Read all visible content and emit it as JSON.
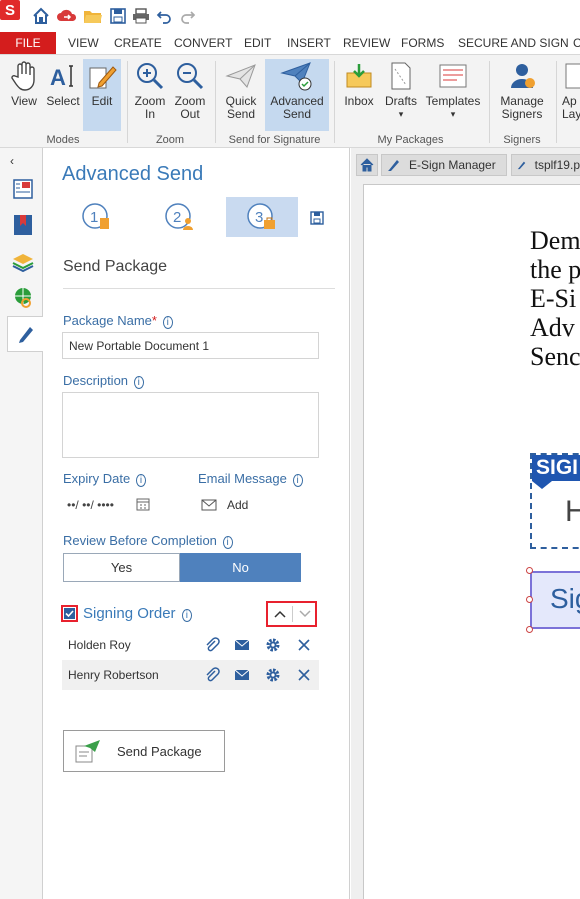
{
  "quick_access": {
    "logo": "S",
    "icons": [
      "home-icon",
      "cloud-icon",
      "open-folder-icon",
      "save-icon",
      "print-icon",
      "undo-icon",
      "redo-icon"
    ]
  },
  "menu": {
    "file": "FILE",
    "items": [
      "VIEW",
      "CREATE",
      "CONVERT",
      "EDIT",
      "INSERT",
      "REVIEW",
      "FORMS",
      "SECURE AND SIGN",
      "C"
    ]
  },
  "ribbon": {
    "modes": {
      "label": "Modes",
      "view": "View",
      "select": "Select",
      "edit": "Edit"
    },
    "zoom": {
      "label": "Zoom",
      "zoom_in_1": "Zoom",
      "zoom_in_2": "In",
      "zoom_out_1": "Zoom",
      "zoom_out_2": "Out"
    },
    "send": {
      "label": "Send for Signature",
      "quick_1": "Quick",
      "quick_2": "Send",
      "adv_1": "Advanced",
      "adv_2": "Send"
    },
    "packages": {
      "label": "My Packages",
      "inbox": "Inbox",
      "drafts": "Drafts",
      "templates": "Templates"
    },
    "signers": {
      "label": "Signers",
      "manage_1": "Manage",
      "manage_2": "Signers"
    },
    "more": {
      "label_1": "Ap",
      "label_2": "Lay"
    }
  },
  "panel": {
    "title": "Advanced Send",
    "steps": [
      "1",
      "2",
      "3"
    ],
    "section_title": "Send Package",
    "package_name_label": "Package Name",
    "required_mark": "*",
    "package_name_value": "New Portable Document 1",
    "description_label": "Description",
    "expiry_label": "Expiry Date",
    "expiry_value": "••/ ••/ ••••",
    "email_label": "Email Message",
    "email_add": "Add",
    "review_label": "Review Before Completion",
    "review_yes": "Yes",
    "review_no": "No",
    "review_selected": "No",
    "signing_order_label": "Signing Order",
    "signing_order_checked": true,
    "signers": [
      "Holden Roy",
      "Henry Robertson"
    ],
    "send_button": "Send Package"
  },
  "document": {
    "tabs": [
      "E-Sign Manager",
      "tsplf19.p"
    ],
    "text_lines": [
      "Dem",
      "the p",
      "E-Si",
      "Adv",
      "Senc"
    ],
    "sig_banner": "SIGI",
    "sig_letter": "H",
    "sig_field": "Sig"
  },
  "colors": {
    "accent": "#3a7ab8",
    "file_red": "#d41d1d",
    "highlight": "#e8212e",
    "selected_segment": "#4f81bd"
  }
}
